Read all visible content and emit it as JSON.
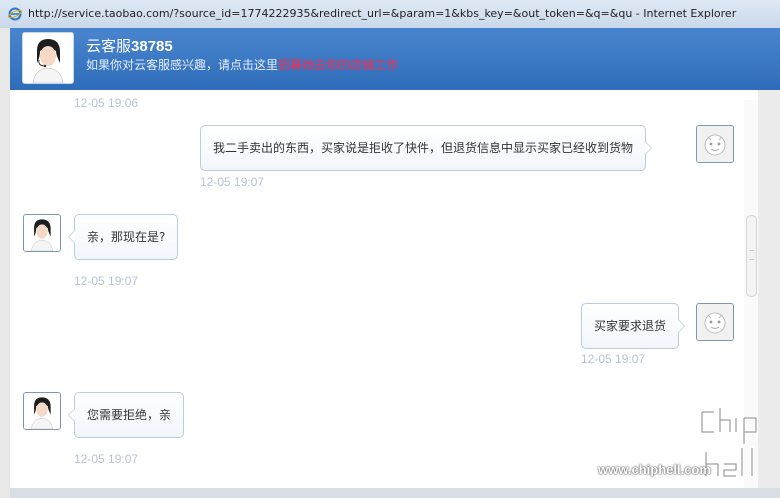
{
  "window": {
    "title": "http://service.taobao.com/?source_id=1774222935&redirect_url=&param=1&kbs_key=&out_token=&q=&qu - Internet Explorer"
  },
  "header": {
    "agent_name_prefix": "云客服",
    "agent_name_id": "38785",
    "subtitle_prefix": "如果你对云客服感兴趣，请点击这里",
    "subtitle_link": "招募她去你的店铺工作",
    "link_color": "#ff2a4a",
    "brand_color": "#3a78c6"
  },
  "chat": {
    "top_timestamp": "12-05 19:06",
    "messages": [
      {
        "side": "right",
        "text": "我二手卖出的东西，买家说是拒收了快件，但退货信息中显示买家已经收到货物",
        "time": "12-05 19:07"
      },
      {
        "side": "left",
        "text": "亲，那现在是?",
        "time": "12-05 19:07"
      },
      {
        "side": "right",
        "text": "买家要求退货",
        "time": "12-05 19:07"
      },
      {
        "side": "left",
        "text": "您需要拒绝，亲",
        "time": "12-05 19:07"
      }
    ]
  },
  "watermark": {
    "url": "www.chiphell.com",
    "logo_text": "chip hell"
  }
}
